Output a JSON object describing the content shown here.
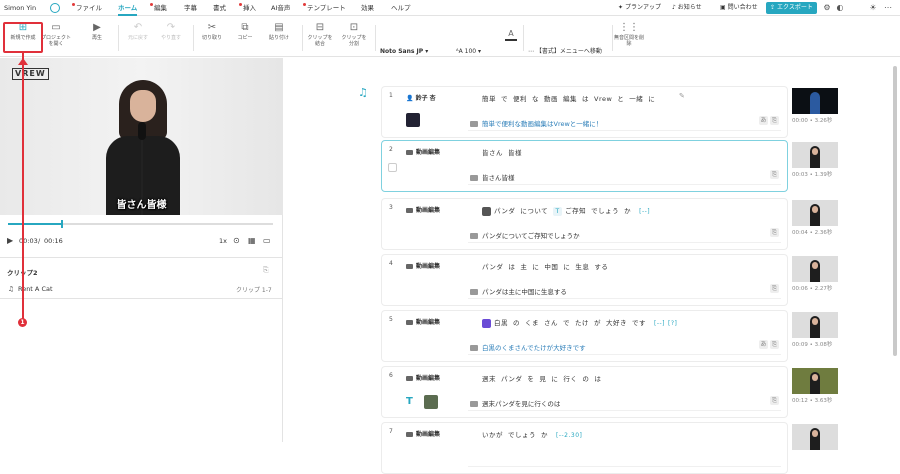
{
  "menubar": {
    "user": "Simon Yin",
    "items": [
      "ファイル",
      "ホーム",
      "編集",
      "字幕",
      "書式",
      "挿入",
      "AI音声",
      "テンプレート",
      "効果",
      "ヘルプ"
    ],
    "active": "ホーム",
    "right": {
      "plan": "プランアップ",
      "news": "お知らせ",
      "contact": "問い合わせ",
      "export": "エクスポート"
    }
  },
  "toolbar": {
    "new_project": "新規で作成",
    "open_project": "プロジェクトを開く",
    "play": "再生",
    "undo": "元に戻す",
    "redo": "やり直す",
    "cut": "切り取り",
    "copy": "コピー",
    "paste": "貼り付け",
    "merge": "クリップを結合",
    "split": "クリップを分割",
    "font": "Noto Sans JP",
    "font_size": "100",
    "menu_move": "【書式】メニューへ移動",
    "remove_silence": "無音区間を削除"
  },
  "player": {
    "logo": "VREW",
    "caption": "皆さん皆様",
    "current": "00:03",
    "duration": "00:16",
    "speed": "1x",
    "progress": 0.2
  },
  "clip_panel": {
    "title": "クリップ2",
    "music": "Rent A Cat",
    "clip_label": "クリップ 1-7"
  },
  "annotation": {
    "marker": "1"
  },
  "rows": [
    {
      "num": "1",
      "speaker": "鈴子 杏",
      "words": [
        "簡単",
        "で",
        "便利",
        "な",
        "動画",
        "編集",
        "は",
        "Vrew",
        "と",
        "一緒",
        "に"
      ],
      "subtitle": "簡単で便利な動画編集はVrewと一緒に！",
      "blue": true,
      "time": "00:00 • 3.26秒",
      "thumb": "dark",
      "tags": [
        "あ"
      ]
    },
    {
      "num": "2",
      "speaker": "動画編集",
      "words": [
        "皆さん",
        "皆様"
      ],
      "subtitle": "皆さん皆様",
      "blue": false,
      "time": "00:03 • 1.39秒",
      "thumb": "person",
      "tags": []
    },
    {
      "num": "3",
      "speaker": "動画編集",
      "words": [
        "パンダ",
        "について",
        "T",
        "ご存知",
        "でしょう",
        "か",
        "[--]"
      ],
      "subtitle": "パンダについてご存知でしょうか",
      "blue": false,
      "time": "00:04 • 2.36秒",
      "thumb": "person",
      "tags": []
    },
    {
      "num": "4",
      "speaker": "動画編集",
      "words": [
        "パンダ",
        "は",
        "主",
        "に",
        "中国",
        "に",
        "生息",
        "する"
      ],
      "subtitle": "パンダは主に中国に生息する",
      "blue": false,
      "time": "00:06 • 2.27秒",
      "thumb": "person",
      "tags": []
    },
    {
      "num": "5",
      "speaker": "動画編集",
      "words": [
        "白黒",
        "の",
        "くま",
        "さん",
        "で",
        "たけ",
        "が",
        "大好き",
        "です",
        "[--]",
        "[?]"
      ],
      "subtitle": "白黒のくまさんでたけが大好きです",
      "blue": true,
      "time": "00:09 • 3.08秒",
      "thumb": "person",
      "tags": [
        "あ"
      ]
    },
    {
      "num": "6",
      "speaker": "動画編集",
      "words": [
        "週末",
        "パンダ",
        "を",
        "見",
        "に",
        "行く",
        "の",
        "は"
      ],
      "subtitle": "週末パンダを見に行くのは",
      "blue": false,
      "time": "00:12 • 3.63秒",
      "thumb": "outdoor",
      "tags": []
    },
    {
      "num": "7",
      "speaker": "動画編集",
      "words": [
        "いかが",
        "でしょう",
        "か",
        "[--2.30]"
      ],
      "subtitle": "",
      "blue": false,
      "time": "",
      "thumb": "person",
      "tags": []
    }
  ]
}
